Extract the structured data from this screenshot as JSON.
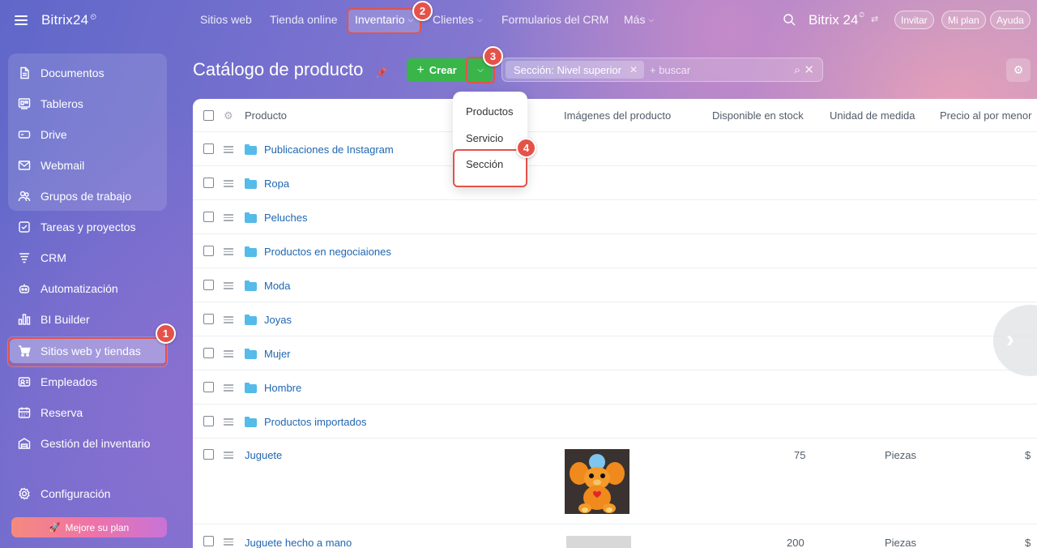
{
  "app": {
    "logo": "Bitrix24",
    "logo_mark": "⏲"
  },
  "sidebar": {
    "items": [
      {
        "label": "Documentos",
        "icon": "document-icon"
      },
      {
        "label": "Tableros",
        "icon": "boards-icon"
      },
      {
        "label": "Drive",
        "icon": "drive-icon"
      },
      {
        "label": "Webmail",
        "icon": "mail-icon"
      },
      {
        "label": "Grupos de trabajo",
        "icon": "groups-icon"
      },
      {
        "label": "Tareas y proyectos",
        "icon": "tasks-icon"
      },
      {
        "label": "CRM",
        "icon": "crm-icon"
      },
      {
        "label": "Automatización",
        "icon": "automation-icon"
      },
      {
        "label": "BI Builder",
        "icon": "bi-icon"
      },
      {
        "label": "Sitios web y tiendas",
        "icon": "cart-icon",
        "active": true
      },
      {
        "label": "Empleados",
        "icon": "employees-icon"
      },
      {
        "label": "Reserva",
        "icon": "calendar-icon"
      },
      {
        "label": "Gestión del inventario",
        "icon": "inventory-icon"
      }
    ],
    "settings_label": "Configuración",
    "upgrade_label": "Mejore su plan"
  },
  "topnav": {
    "items": [
      "Sitios web",
      "Tienda online",
      "Inventario",
      "Clientes",
      "Formularios del CRM",
      "Más"
    ],
    "brand": "Bitrix 24",
    "invite": "Invitar",
    "my_plan": "Mi plan",
    "help": "Ayuda"
  },
  "page": {
    "title": "Catálogo de producto",
    "create_label": "Crear",
    "filter_chip": "Sección: Nivel superior",
    "search_placeholder": "+ buscar"
  },
  "table": {
    "headers": [
      "Producto",
      "Imágenes del producto",
      "Disponible en stock",
      "Unidad de medida",
      "Precio al por menor"
    ],
    "sections": [
      "Publicaciones de Instagram",
      "Ropa",
      "Peluches",
      "Productos en negociaiones",
      "Moda",
      "Joyas",
      "Mujer",
      "Hombre",
      "Productos importados"
    ],
    "products": [
      {
        "name": "Juguete",
        "stock": "75",
        "unit": "Piezas",
        "price": "$"
      },
      {
        "name": "Juguete hecho a mano",
        "stock": "200",
        "unit": "Piezas",
        "price": "$"
      }
    ]
  },
  "create_dropdown": {
    "items": [
      "Productos",
      "Servicio",
      "Sección"
    ]
  },
  "steps": [
    "1",
    "2",
    "3",
    "4"
  ],
  "colors": {
    "accent_green": "#39b54a",
    "highlight_red": "#e5524a",
    "link_blue": "#2067b0"
  }
}
